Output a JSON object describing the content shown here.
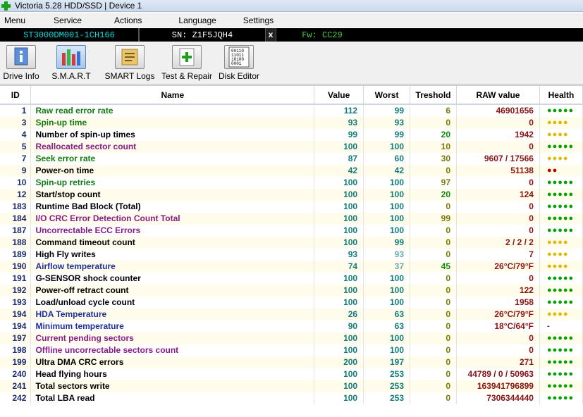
{
  "window": {
    "title": "Victoria 5.28 HDD/SSD | Device 1"
  },
  "menu": [
    "Menu",
    "Service",
    "Actions",
    "Language",
    "Settings"
  ],
  "device": {
    "model": "ST3000DM001-1CH166",
    "serial": "SN: Z1F5JQH4",
    "close": "x",
    "firmware": "Fw: CC29"
  },
  "toolbar": [
    "Drive Info",
    "S.M.A.R.T",
    "SMART Logs",
    "Test & Repair",
    "Disk Editor"
  ],
  "icons": {
    "drive_info": "info-icon",
    "smart": "smart-bars-icon",
    "smart_logs": "logs-icon",
    "test_repair": "first-aid-icon",
    "disk_editor": "binary-icon",
    "disk_editor_text": [
      "00110",
      "11011",
      "10100",
      "0001"
    ]
  },
  "table": {
    "headers": [
      "ID",
      "Name",
      "Value",
      "Worst",
      "Treshold",
      "RAW value",
      "Health"
    ],
    "rows": [
      {
        "id": "1",
        "name": "Raw read error rate",
        "value": "112",
        "worst": "99",
        "threshold": "6",
        "raw": "46901656",
        "health": "●●●●●"
      },
      {
        "id": "3",
        "name": "Spin-up time",
        "value": "93",
        "worst": "93",
        "threshold": "0",
        "raw": "0",
        "health": "●●●●"
      },
      {
        "id": "4",
        "name": "Number of spin-up times",
        "value": "99",
        "worst": "99",
        "threshold": "20",
        "raw": "1942",
        "health": "●●●●"
      },
      {
        "id": "5",
        "name": "Reallocated sector count",
        "value": "100",
        "worst": "100",
        "threshold": "10",
        "raw": "0",
        "health": "●●●●●"
      },
      {
        "id": "7",
        "name": "Seek error rate",
        "value": "87",
        "worst": "60",
        "threshold": "30",
        "raw": "9607 / 17566",
        "health": "●●●●"
      },
      {
        "id": "9",
        "name": "Power-on time",
        "value": "42",
        "worst": "42",
        "threshold": "0",
        "raw": "51138",
        "health": "●●"
      },
      {
        "id": "10",
        "name": "Spin-up retries",
        "value": "100",
        "worst": "100",
        "threshold": "97",
        "raw": "0",
        "health": "●●●●●"
      },
      {
        "id": "12",
        "name": "Start/stop count",
        "value": "100",
        "worst": "100",
        "threshold": "20",
        "raw": "124",
        "health": "●●●●●"
      },
      {
        "id": "183",
        "name": "Runtime Bad Block (Total)",
        "value": "100",
        "worst": "100",
        "threshold": "0",
        "raw": "0",
        "health": "●●●●●"
      },
      {
        "id": "184",
        "name": "I/O CRC Error Detection Count Total",
        "value": "100",
        "worst": "100",
        "threshold": "99",
        "raw": "0",
        "health": "●●●●●"
      },
      {
        "id": "187",
        "name": "Uncorrectable ECC Errors",
        "value": "100",
        "worst": "100",
        "threshold": "0",
        "raw": "0",
        "health": "●●●●●"
      },
      {
        "id": "188",
        "name": "Command timeout count",
        "value": "100",
        "worst": "99",
        "threshold": "0",
        "raw": "2 / 2 / 2",
        "health": "●●●●"
      },
      {
        "id": "189",
        "name": "High Fly writes",
        "value": "93",
        "worst": "93",
        "threshold": "0",
        "raw": "7",
        "health": "●●●●"
      },
      {
        "id": "190",
        "name": "Airflow temperature",
        "value": "74",
        "worst": "37",
        "threshold": "45",
        "raw": "26°C/79°F",
        "health": "●●●●"
      },
      {
        "id": "191",
        "name": "G-SENSOR shock counter",
        "value": "100",
        "worst": "100",
        "threshold": "0",
        "raw": "0",
        "health": "●●●●●"
      },
      {
        "id": "192",
        "name": "Power-off retract count",
        "value": "100",
        "worst": "100",
        "threshold": "0",
        "raw": "122",
        "health": "●●●●●"
      },
      {
        "id": "193",
        "name": "Load/unload cycle count",
        "value": "100",
        "worst": "100",
        "threshold": "0",
        "raw": "1958",
        "health": "●●●●●"
      },
      {
        "id": "194",
        "name": "HDA Temperature",
        "value": "26",
        "worst": "63",
        "threshold": "0",
        "raw": "26°C/79°F",
        "health": "●●●●"
      },
      {
        "id": "194",
        "name": "Minimum temperature",
        "value": "90",
        "worst": "63",
        "threshold": "0",
        "raw": "18°C/64°F",
        "health": "-"
      },
      {
        "id": "197",
        "name": "Current pending sectors",
        "value": "100",
        "worst": "100",
        "threshold": "0",
        "raw": "0",
        "health": "●●●●●"
      },
      {
        "id": "198",
        "name": "Offline uncorrectable sectors count",
        "value": "100",
        "worst": "100",
        "threshold": "0",
        "raw": "0",
        "health": "●●●●●"
      },
      {
        "id": "199",
        "name": "Ultra DMA CRC errors",
        "value": "200",
        "worst": "197",
        "threshold": "0",
        "raw": "271",
        "health": "●●●●●"
      },
      {
        "id": "240",
        "name": "Head flying hours",
        "value": "100",
        "worst": "253",
        "threshold": "0",
        "raw": "44789 / 0 / 50963",
        "health": "●●●●●"
      },
      {
        "id": "241",
        "name": "Total sectors write",
        "value": "100",
        "worst": "253",
        "threshold": "0",
        "raw": "163941796899",
        "health": "●●●●●"
      },
      {
        "id": "242",
        "name": "Total LBA read",
        "value": "100",
        "worst": "253",
        "threshold": "0",
        "raw": "7306344440",
        "health": "●●●●●"
      }
    ]
  }
}
